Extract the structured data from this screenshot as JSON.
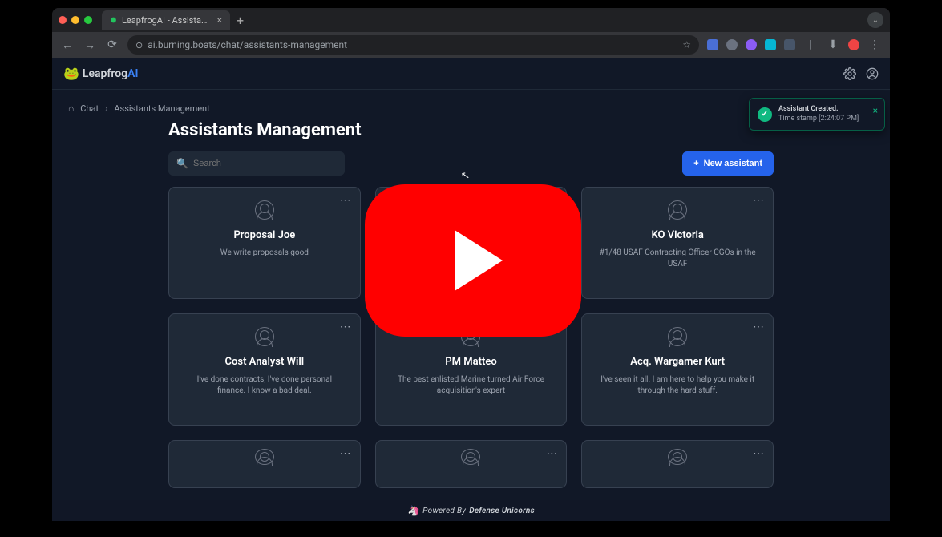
{
  "browser": {
    "tab_title": "LeapfrogAI - Assistants Mana",
    "url": "ai.burning.boats/chat/assistants-management"
  },
  "app": {
    "logo_a": "Leapfrog",
    "logo_b": "AI"
  },
  "breadcrumb": {
    "item1": "Chat",
    "item2": "Assistants Management"
  },
  "page": {
    "title": "Assistants Management"
  },
  "search": {
    "placeholder": "Search"
  },
  "buttons": {
    "new_assistant": "New assistant"
  },
  "toast": {
    "title": "Assistant Created.",
    "sub": "Time stamp [2:24:07 PM]"
  },
  "footer": {
    "text_a": "Powered By",
    "text_b": "Defense Unicorns"
  },
  "assistants": [
    {
      "name": "Proposal Joe",
      "desc": "We write proposals good"
    },
    {
      "name": "",
      "desc": ""
    },
    {
      "name": "KO Victoria",
      "desc": "#1/48 USAF Contracting Officer CGOs in the USAF"
    },
    {
      "name": "Cost Analyst Will",
      "desc": "I've done contracts, I've done personal finance. I know a bad deal."
    },
    {
      "name": "PM Matteo",
      "desc": "The best enlisted Marine turned Air Force acquisition's expert"
    },
    {
      "name": "Acq. Wargamer Kurt",
      "desc": "I've seen it all. I am here to help you make it through the hard stuff."
    },
    {
      "name": "",
      "desc": ""
    },
    {
      "name": "",
      "desc": ""
    },
    {
      "name": "",
      "desc": ""
    }
  ]
}
